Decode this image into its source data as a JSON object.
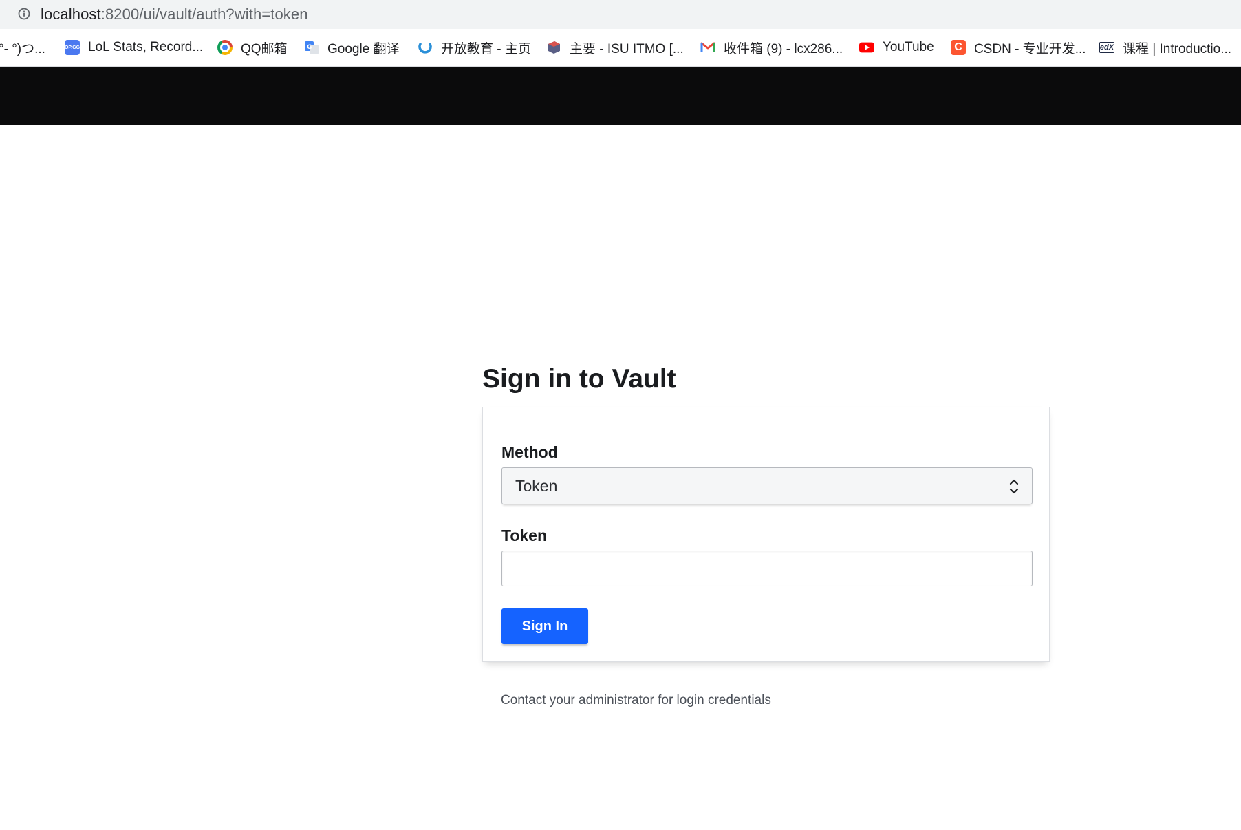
{
  "browser": {
    "url_host": "localhost",
    "url_path": ":8200/ui/vault/auth?with=token",
    "bookmarks": [
      {
        "label": "°- °)つ...",
        "icon": "none"
      },
      {
        "label": "LoL Stats, Record...",
        "icon": "opgg-icon"
      },
      {
        "label": "QQ邮箱",
        "icon": "qqmail-icon"
      },
      {
        "label": "Google 翻译",
        "icon": "google-translate-icon"
      },
      {
        "label": "开放教育 - 主页",
        "icon": "open-education-icon"
      },
      {
        "label": "主要 - ISU ITMO [...",
        "icon": "itmo-icon"
      },
      {
        "label": "收件箱 (9) - lcx286...",
        "icon": "gmail-icon"
      },
      {
        "label": "YouTube",
        "icon": "youtube-icon"
      },
      {
        "label": "CSDN - 专业开发...",
        "icon": "csdn-icon"
      },
      {
        "label": "课程 | Introductio...",
        "icon": "edx-icon"
      }
    ]
  },
  "page": {
    "title": "Sign in to Vault",
    "method_label": "Method",
    "method_value": "Token",
    "token_label": "Token",
    "token_value": "",
    "signin_button": "Sign In",
    "help_text": "Contact your administrator for login credentials"
  },
  "colors": {
    "header_bg": "#0b0b0c",
    "primary_button": "#1563ff"
  }
}
